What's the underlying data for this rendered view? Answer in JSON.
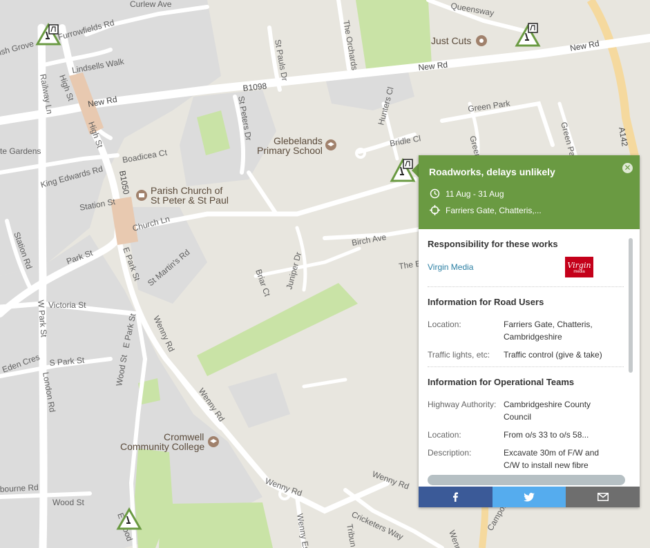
{
  "map": {
    "streets": {
      "curlew_ave": "Curlew Ave",
      "furrowfields_rd": "Furrowfields Rd",
      "ish_grove": "ish Grove",
      "railway_ln": "Railway Ln",
      "high_st_1": "High St",
      "high_st_2": "High St",
      "lindsells_walk": "Lindsells Walk",
      "new_rd_1": "New Rd",
      "new_rd_2": "New Rd",
      "new_rd_3": "New Rd",
      "b1098": "B1098",
      "st_pauls_dr": "St Pauls Dr",
      "st_peters_dr": "St Peters Dr",
      "the_orchards": "The Orchards",
      "queensway": "Queensway",
      "hunters_cl": "Hunters Cl",
      "green_park": "Green Park",
      "green_park_2": "Green Park",
      "green_2": "Green",
      "a142": "A142",
      "bridle_cl": "Bridle Cl",
      "te_gardens": "te Gardens",
      "boadicea_ct": "Boadicea Ct",
      "king_edwards_rd": "King Edwards Rd",
      "b1050": "B1050",
      "station_st": "Station St",
      "church_ln": "Church Ln",
      "station_rd": "Station Rd",
      "park_st": "Park St",
      "e_park_st": "E Park St",
      "st_martins_rd": "St Martin's Rd",
      "briar_ct": "Briar Ct",
      "juniper_dr": "Juniper Dr",
      "birch_ave": "Birch Ave",
      "the_e": "The E",
      "w_park_st": "W Park St",
      "victoria_st": "Victoria St",
      "eden_cres": "Eden Cres",
      "s_park_st": "S Park St",
      "e_park_st_2": "E Park St",
      "wenny_rd_1": "Wenny Rd",
      "wood_st_1": "Wood St",
      "london_rd": "London Rd",
      "wenny_rd_2": "Wenny Rd",
      "wenny_rd_3": "Wenny Rd",
      "wenny_rd_4": "Wenny Rd",
      "wenny_es": "Wenny Es",
      "bourne_rd": "bourne Rd",
      "wood_st_2": "Wood St",
      "e_wood": "E Wood",
      "cricketers_way": "Cricketers Way",
      "tribun": "Tribun",
      "campole": "Campole D",
      "wenn": "Wenn"
    },
    "pois": {
      "just_cuts": "Just Cuts",
      "glebelands_1": "Glebelands",
      "glebelands_2": "Primary School",
      "parish_1": "Parish Church of",
      "parish_2": "St Peter & St Paul",
      "cromwell_1": "Cromwell",
      "cromwell_2": "Community College"
    },
    "colors": {
      "land": "#e8e6df",
      "urban": "#dcdcdc",
      "road": "#ffffff",
      "park": "#c9e3a6",
      "highway": "#f5d99e",
      "marker": "#6a9a42"
    }
  },
  "popup": {
    "title": "Roadworks, delays unlikely",
    "dates": "11 Aug - 31 Aug",
    "location_short": "Farriers Gate, Chatteris,...",
    "close_icon": "close-icon",
    "responsibility_title": "Responsibility for these works",
    "owner_name": "Virgin Media",
    "owner_logo_text": "Virgin",
    "owner_logo_sub": "media",
    "road_users_title": "Information for Road Users",
    "road_users": [
      {
        "label": "Location:",
        "value": "Farriers Gate, Chatteris, Cambridgeshire"
      },
      {
        "label": "Traffic lights, etc:",
        "value": "Traffic control (give & take)"
      }
    ],
    "ops_title": "Information for Operational Teams",
    "highway_label": "Highway Authority:",
    "highway_value": "Cambridgeshire County Council",
    "ops_location_label": "Location:",
    "ops_location_value": "From o/s 33 to o/s 58...",
    "description_label": "Description:",
    "description_value": "Excavate 30m of F/W and C/W to install new fibre"
  },
  "share": {
    "facebook_icon": "facebook-icon",
    "twitter_icon": "twitter-icon",
    "email_icon": "email-icon"
  }
}
